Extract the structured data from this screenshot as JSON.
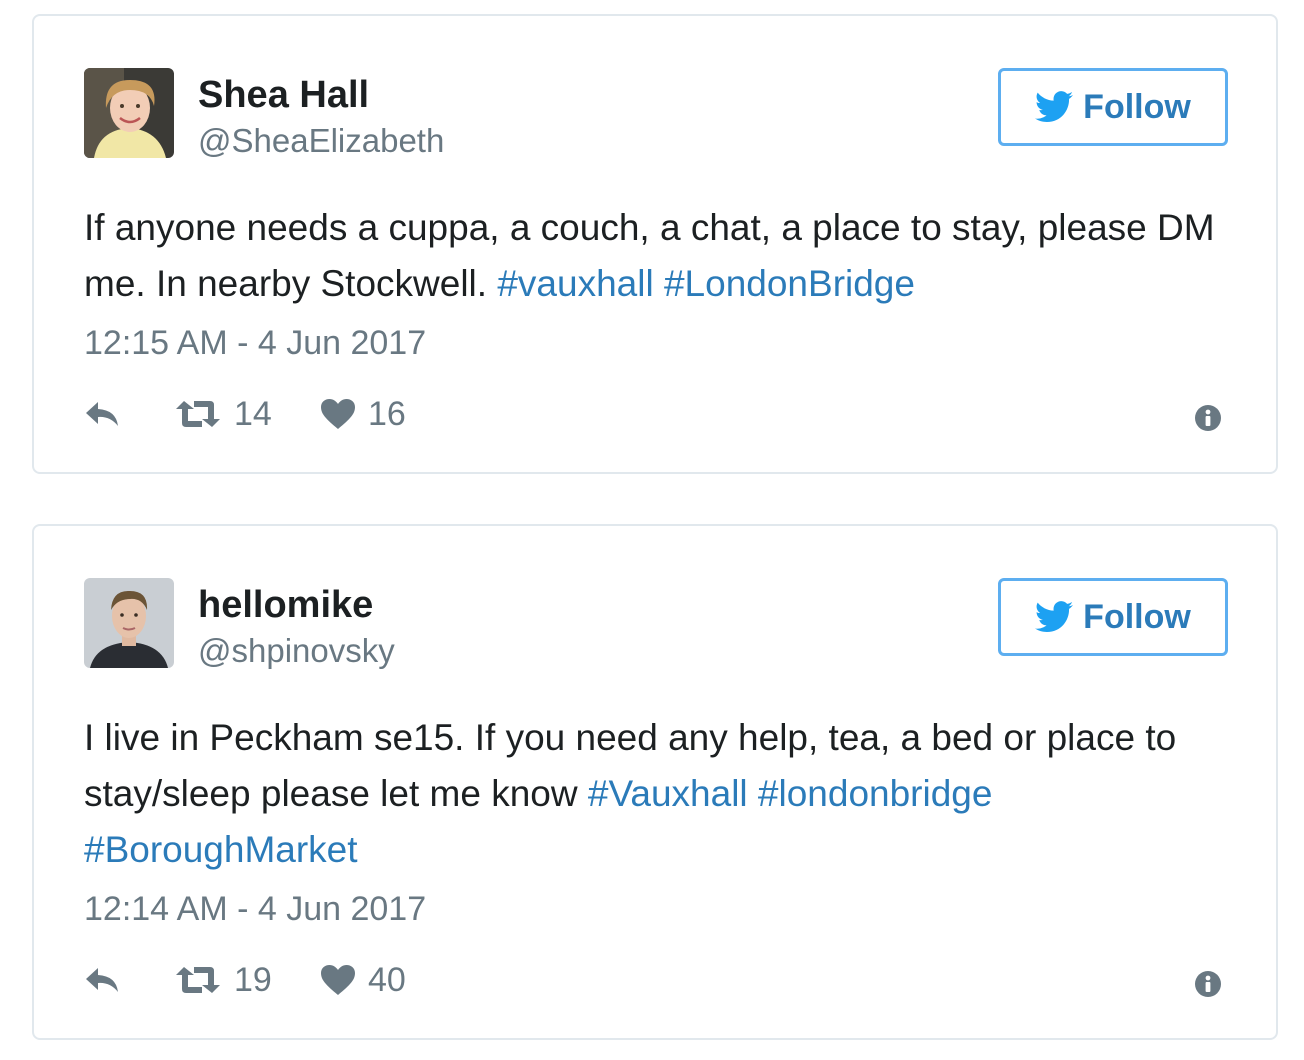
{
  "colors": {
    "border": "#e1e8ed",
    "name": "#1c2022",
    "muted": "#697882",
    "link": "#2b7bb9",
    "follow_border": "#5daef0",
    "bird": "#1da1f2"
  },
  "tweets": [
    {
      "author_name": "Shea Hall",
      "handle": "@SheaElizabeth",
      "follow_label": "Follow",
      "text_parts": [
        "If anyone needs a cuppa, a couch, a chat, a place to stay, please DM me. In nearby Stockwell. ",
        "#vauxhall",
        " ",
        "#LondonBridge"
      ],
      "timestamp": "12:15 AM - 4 Jun 2017",
      "retweets": "14",
      "likes": "16"
    },
    {
      "author_name": "hellomike",
      "handle": "@shpinovsky",
      "follow_label": "Follow",
      "text_parts": [
        "I live in Peckham se15. If you need any help, tea, a bed or place to stay/sleep please let me know ",
        "#Vauxhall",
        " ",
        "#londonbridge",
        " ",
        "#BoroughMarket"
      ],
      "timestamp": "12:14 AM - 4 Jun 2017",
      "retweets": "19",
      "likes": "40"
    }
  ],
  "icons": {
    "follow": "twitter-bird-icon",
    "reply": "reply-arrow-icon",
    "retweet": "retweet-icon",
    "like": "heart-icon",
    "info": "info-circle-icon"
  }
}
